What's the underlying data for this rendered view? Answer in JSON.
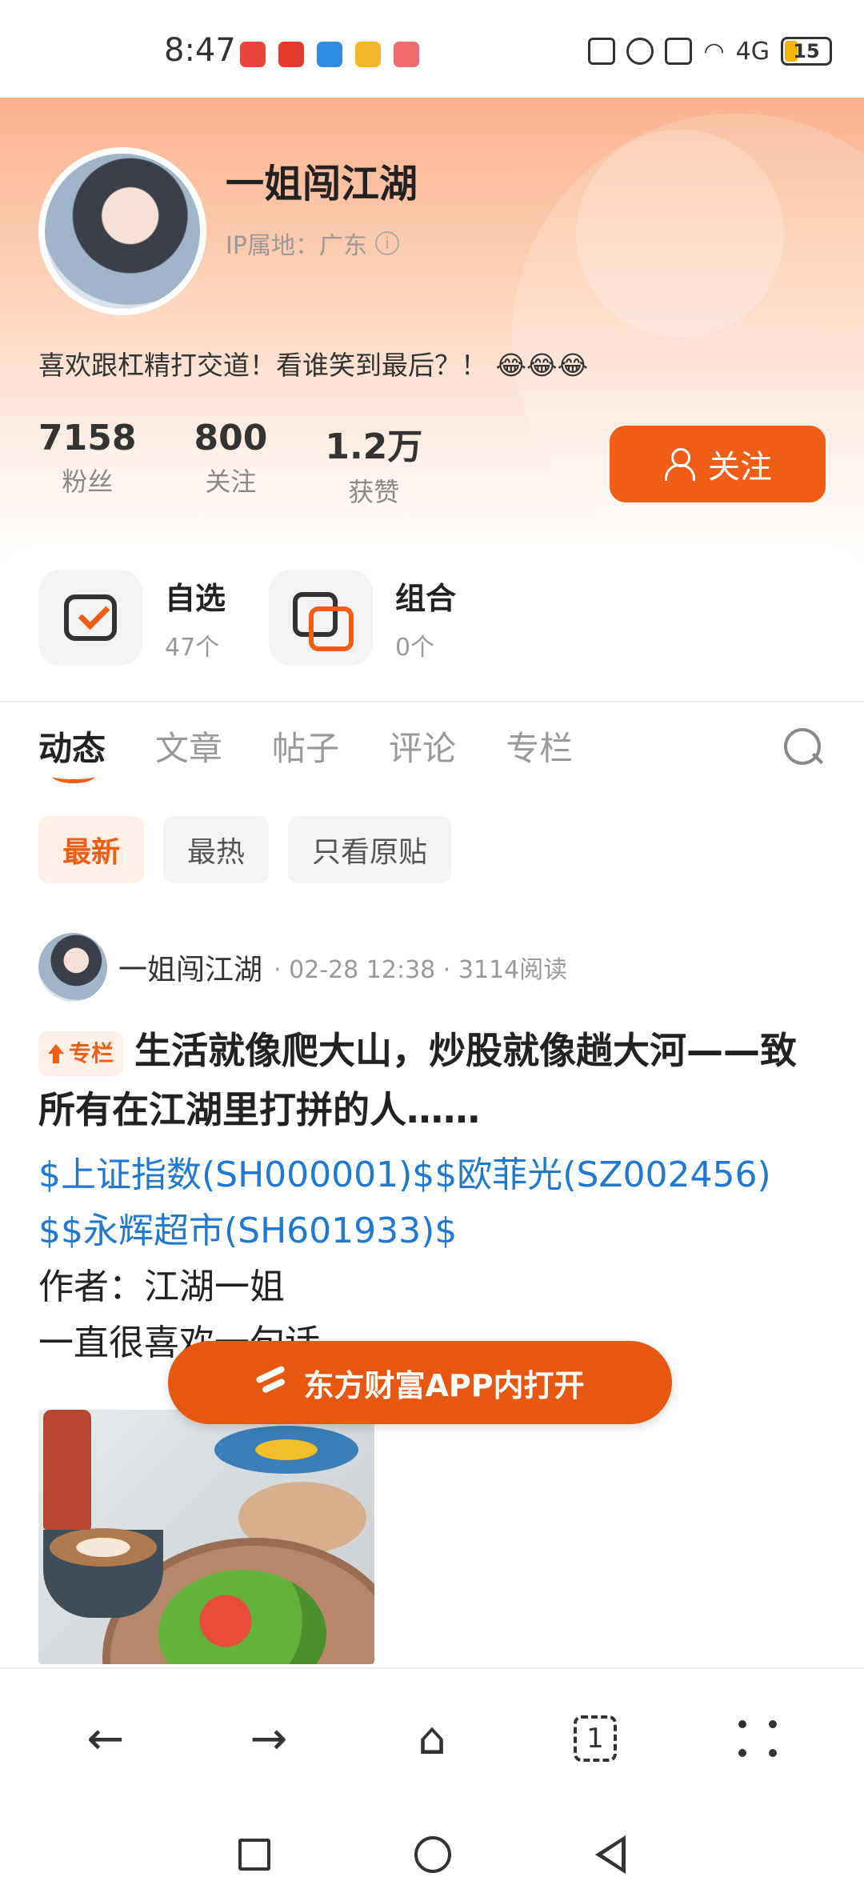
{
  "status_bar": {
    "time": "8:47",
    "network": "4G",
    "battery": "15"
  },
  "profile": {
    "name": "一姐闯江湖",
    "ip_location": "IP属地：广东",
    "bio": "喜欢跟杠精打交道！看谁笑到最后？！ 😂😂😂",
    "stats": [
      {
        "value": "7158",
        "label": "粉丝"
      },
      {
        "value": "800",
        "label": "关注"
      },
      {
        "value": "1.2万",
        "label": "获赞"
      }
    ],
    "follow_label": "关注"
  },
  "shortcuts": [
    {
      "title": "自选",
      "count": "47个"
    },
    {
      "title": "组合",
      "count": "0个"
    }
  ],
  "tabs": [
    "动态",
    "文章",
    "帖子",
    "评论",
    "专栏"
  ],
  "active_tab": "动态",
  "filters": [
    "最新",
    "最热",
    "只看原贴"
  ],
  "active_filter": "最新",
  "post": {
    "author": "一姐闯江湖",
    "time": "· 02-28 12:38 · 3114阅读",
    "badge": "专栏",
    "title": "生活就像爬大山，炒股就像趟大河——致所有在江湖里打拼的人……",
    "links": "$上证指数(SH000001)$$欧菲光(SZ002456)$$永辉超市(SH601933)$",
    "author_line": "作者：江湖一姐",
    "body_line": "一直很喜欢一句话"
  },
  "open_app_label": "东方财富APP内打开",
  "browser_nav": {
    "tab_count": "1"
  },
  "colors": {
    "accent": "#f05e15",
    "link": "#1f78d1"
  }
}
